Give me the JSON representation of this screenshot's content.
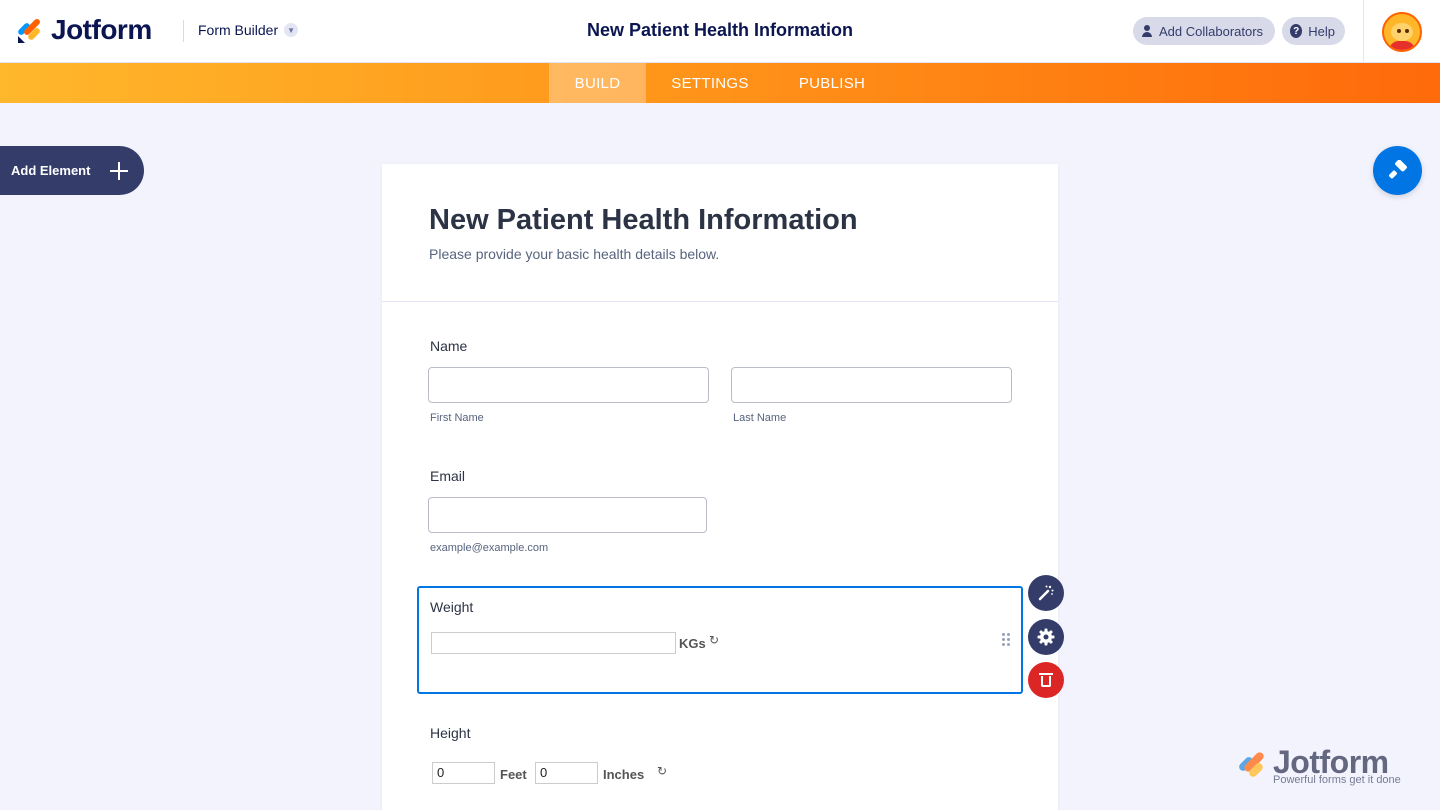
{
  "header": {
    "logo_text": "Jotform",
    "builder_label": "Form Builder",
    "title": "New Patient Health Information",
    "add_collaborators": "Add Collaborators",
    "help": "Help"
  },
  "nav": {
    "tabs": [
      {
        "label": "BUILD",
        "active": true
      },
      {
        "label": "SETTINGS",
        "active": false
      },
      {
        "label": "PUBLISH",
        "active": false
      }
    ]
  },
  "sidebar": {
    "add_element": "Add Element"
  },
  "form": {
    "title": "New Patient Health Information",
    "subtitle": "Please provide your basic health details below.",
    "fields": {
      "name": {
        "label": "Name",
        "first_sublabel": "First Name",
        "last_sublabel": "Last Name"
      },
      "email": {
        "label": "Email",
        "sublabel": "example@example.com"
      },
      "weight": {
        "label": "Weight",
        "unit": "KGs",
        "value": ""
      },
      "height": {
        "label": "Height",
        "feet_value": "0",
        "feet_unit": "Feet",
        "inches_value": "0",
        "inches_unit": "Inches"
      }
    }
  },
  "watermark": {
    "text": "Jotform",
    "tagline": "Powerful forms get it done"
  },
  "colors": {
    "brand_navy": "#0a1551",
    "accent_orange": "#ff6100",
    "accent_blue": "#0075e3",
    "delete_red": "#dc2626"
  },
  "icons": [
    "wand-icon",
    "gear-icon",
    "trash-icon",
    "plus-icon",
    "paint-roller-icon",
    "reset-icon",
    "drag-handle-icon"
  ]
}
